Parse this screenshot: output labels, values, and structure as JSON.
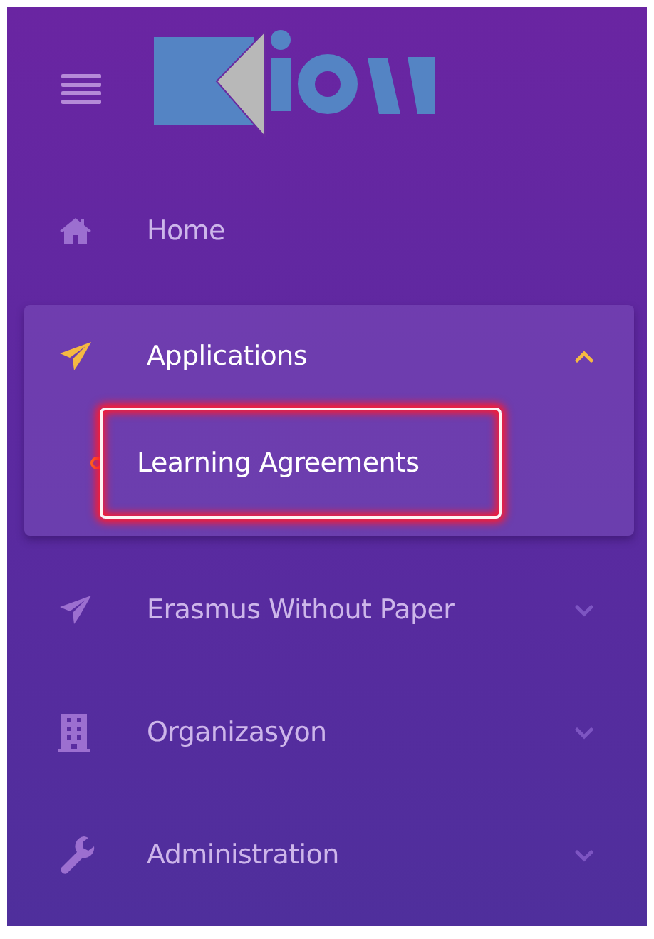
{
  "menu": [
    {
      "label": "Home",
      "active": false
    },
    {
      "label": "Applications",
      "active": true,
      "expanded": true,
      "children": [
        {
          "label": "Learning Agreements",
          "selected": true,
          "highlighted": true
        }
      ]
    },
    {
      "label": "Erasmus Without Paper",
      "active": false,
      "expanded": false
    },
    {
      "label": "Organizasyon",
      "active": false,
      "expanded": false
    },
    {
      "label": "Administration",
      "active": false,
      "expanded": false
    }
  ]
}
